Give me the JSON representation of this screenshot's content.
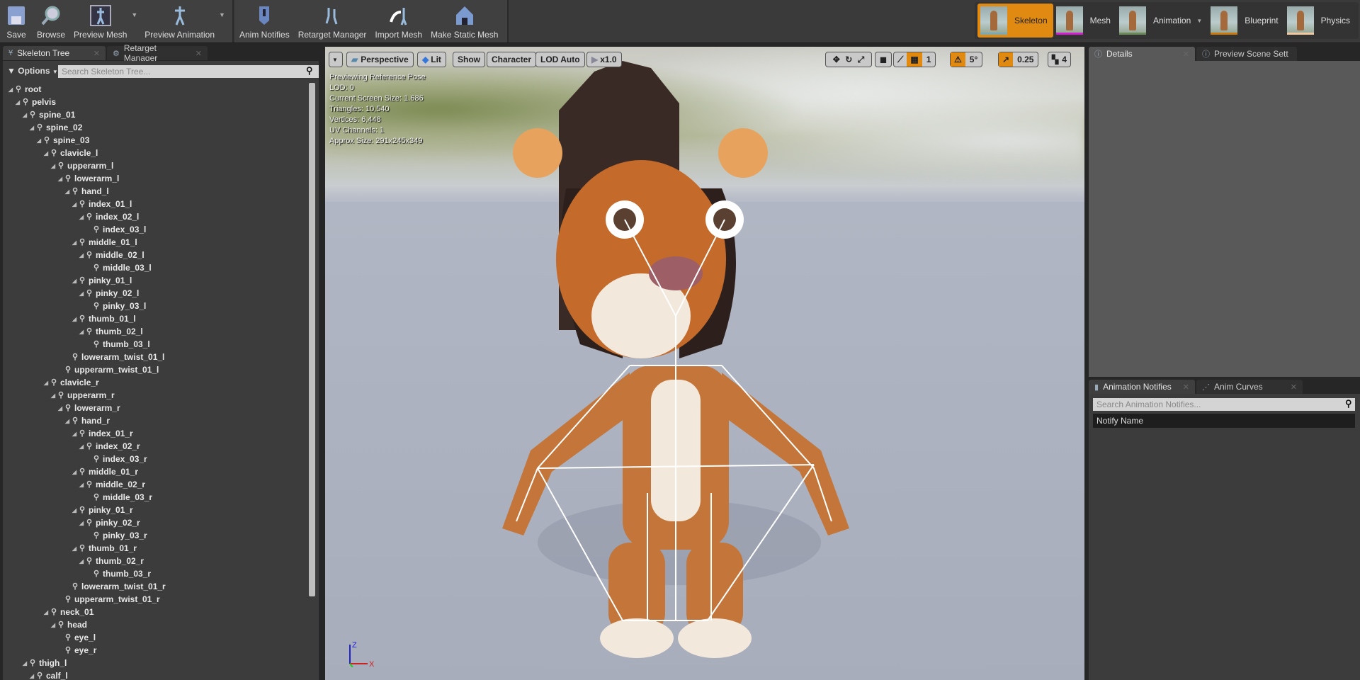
{
  "toolbar": {
    "buttons": [
      {
        "label": "Save",
        "icon": "save-icon"
      },
      {
        "label": "Browse",
        "icon": "browse-icon"
      },
      {
        "label": "Preview Mesh",
        "icon": "preview-mesh-icon"
      },
      {
        "label": "Preview Animation",
        "icon": "preview-animation-icon"
      },
      {
        "label": "Anim Notifies",
        "icon": "anim-notifies-icon"
      },
      {
        "label": "Retarget Manager",
        "icon": "retarget-manager-icon"
      },
      {
        "label": "Import Mesh",
        "icon": "import-mesh-icon"
      },
      {
        "label": "Make Static Mesh",
        "icon": "make-static-mesh-icon"
      }
    ]
  },
  "modes": [
    {
      "label": "Skeleton",
      "active": true,
      "color": "#7ab"
    },
    {
      "label": "Mesh",
      "color": "#d020d0"
    },
    {
      "label": "Animation",
      "color": "#6a8a5a"
    },
    {
      "label": "Blueprint",
      "color": "#c87a10"
    },
    {
      "label": "Physics",
      "color": "#f0c8a0"
    }
  ],
  "left": {
    "tabs": [
      {
        "label": "Skeleton Tree"
      },
      {
        "label": "Retarget Manager"
      }
    ],
    "options_label": "Options",
    "search_placeholder": "Search Skeleton Tree...",
    "bones": [
      [
        "root",
        0,
        1
      ],
      [
        "pelvis",
        1,
        1
      ],
      [
        "spine_01",
        2,
        1
      ],
      [
        "spine_02",
        3,
        1
      ],
      [
        "spine_03",
        4,
        1
      ],
      [
        "clavicle_l",
        5,
        1
      ],
      [
        "upperarm_l",
        6,
        1
      ],
      [
        "lowerarm_l",
        7,
        1
      ],
      [
        "hand_l",
        8,
        1
      ],
      [
        "index_01_l",
        9,
        1
      ],
      [
        "index_02_l",
        10,
        1
      ],
      [
        "index_03_l",
        11,
        0
      ],
      [
        "middle_01_l",
        9,
        1
      ],
      [
        "middle_02_l",
        10,
        1
      ],
      [
        "middle_03_l",
        11,
        0
      ],
      [
        "pinky_01_l",
        9,
        1
      ],
      [
        "pinky_02_l",
        10,
        1
      ],
      [
        "pinky_03_l",
        11,
        0
      ],
      [
        "thumb_01_l",
        9,
        1
      ],
      [
        "thumb_02_l",
        10,
        1
      ],
      [
        "thumb_03_l",
        11,
        0
      ],
      [
        "lowerarm_twist_01_l",
        8,
        0
      ],
      [
        "upperarm_twist_01_l",
        7,
        0
      ],
      [
        "clavicle_r",
        5,
        1
      ],
      [
        "upperarm_r",
        6,
        1
      ],
      [
        "lowerarm_r",
        7,
        1
      ],
      [
        "hand_r",
        8,
        1
      ],
      [
        "index_01_r",
        9,
        1
      ],
      [
        "index_02_r",
        10,
        1
      ],
      [
        "index_03_r",
        11,
        0
      ],
      [
        "middle_01_r",
        9,
        1
      ],
      [
        "middle_02_r",
        10,
        1
      ],
      [
        "middle_03_r",
        11,
        0
      ],
      [
        "pinky_01_r",
        9,
        1
      ],
      [
        "pinky_02_r",
        10,
        1
      ],
      [
        "pinky_03_r",
        11,
        0
      ],
      [
        "thumb_01_r",
        9,
        1
      ],
      [
        "thumb_02_r",
        10,
        1
      ],
      [
        "thumb_03_r",
        11,
        0
      ],
      [
        "lowerarm_twist_01_r",
        8,
        0
      ],
      [
        "upperarm_twist_01_r",
        7,
        0
      ],
      [
        "neck_01",
        5,
        1
      ],
      [
        "head",
        6,
        1
      ],
      [
        "eye_l",
        7,
        0
      ],
      [
        "eye_r",
        7,
        0
      ],
      [
        "thigh_l",
        2,
        1
      ],
      [
        "calf_l",
        3,
        1
      ]
    ]
  },
  "viewport": {
    "buttons": {
      "perspective": "Perspective",
      "lit": "Lit",
      "show": "Show",
      "character": "Character",
      "lod": "LOD Auto",
      "speed": "x1.0"
    },
    "right_tools": {
      "grid_snap": "1",
      "rot_snap": "5°",
      "scale_snap": "0.25",
      "camera_speed": "4"
    },
    "info": [
      "Previewing Reference Pose",
      "LOD: 0",
      "Current Screen Size: 1.686",
      "Triangles: 10,540",
      "Vertices: 6,448",
      "UV Channels: 1",
      "Approx Size: 291x245x349"
    ],
    "axes": {
      "z": "Z",
      "x": "X"
    }
  },
  "right": {
    "tabs": [
      {
        "label": "Details"
      },
      {
        "label": "Preview Scene Sett"
      }
    ],
    "bottom_tabs": [
      {
        "label": "Animation Notifies"
      },
      {
        "label": "Anim Curves"
      }
    ],
    "notify_search_placeholder": "Search Animation Notifies...",
    "notify_column": "Notify Name"
  }
}
